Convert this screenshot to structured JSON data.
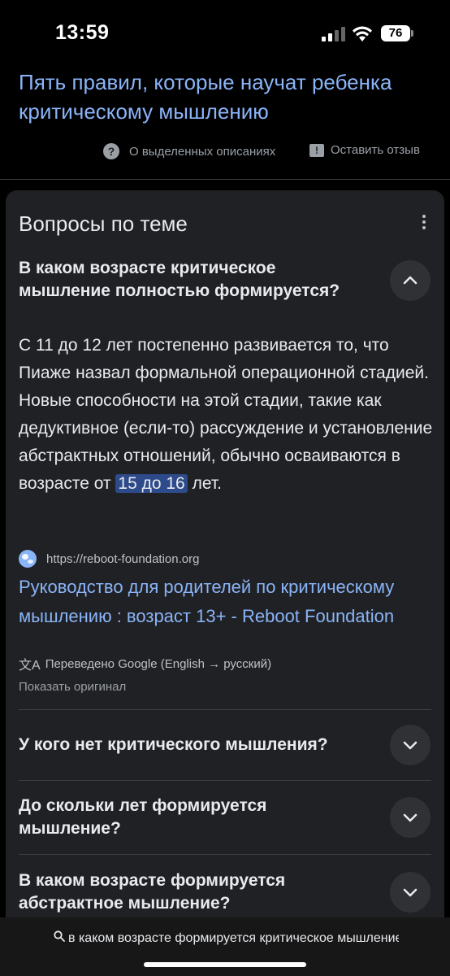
{
  "status": {
    "time": "13:59",
    "battery": "76"
  },
  "result": {
    "title": "Пять правил, которые научат ребенка критическому мышлению",
    "about_label": "О выделенных описаниях",
    "feedback_label": "Оставить отзыв"
  },
  "card": {
    "title": "Вопросы по теме",
    "expanded_question": "В каком возрасте критическое мышление полностью формируется?",
    "answer_before": "С 11 до 12 лет постепенно развивается то, что Пиаже назвал формальной операционной стадией. Новые способности на этой стадии, такие как дедуктивное (если-то) рассуждение и установление абстрактных отношений, обычно осваиваются в возрасте от ",
    "answer_highlight": "15 до 16",
    "answer_after": " лет.",
    "source_url": "https://reboot-foundation.org",
    "source_title": "Руководство для родителей по критическому мышлению : возраст 13+ - Reboot Foundation",
    "translated_label": "Переведено Google (English → русский)",
    "show_original": "Показать оригинал",
    "questions": [
      "У кого нет критического мышления?",
      "До скольки лет формируется мышление?",
      "В каком возрасте формируется абстрактное мышление?"
    ]
  },
  "bottom": {
    "search_text": "в каком возрасте формируется критическое мышление"
  },
  "colors": {
    "link": "#8ab4f8",
    "card_bg": "#202124",
    "highlight": "#2d4a8a"
  }
}
